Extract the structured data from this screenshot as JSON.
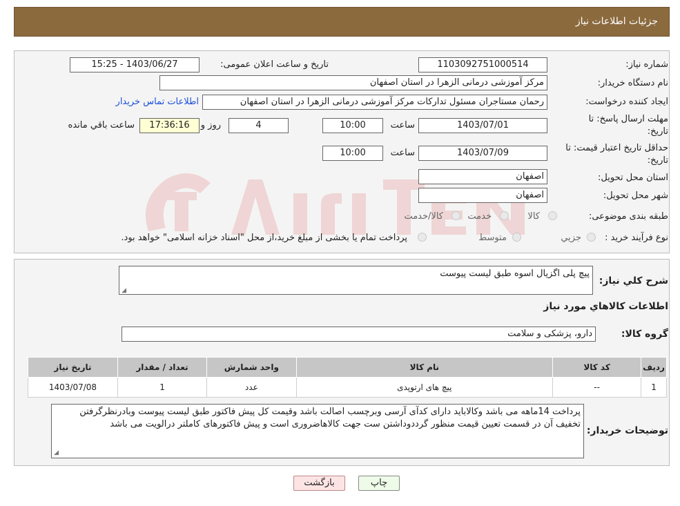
{
  "header": {
    "title": "جزئیات اطلاعات نیاز"
  },
  "form": {
    "need_number_label": "شماره نیاز:",
    "need_number": "1103092751000514",
    "announce_label": "تاریخ و ساعت اعلان عمومی:",
    "announce_value": "1403/06/27 - 15:25",
    "buyer_label": "نام دستگاه خریدار:",
    "buyer_value": "مرکز آموزشی درمانی الزهرا در استان اصفهان",
    "creator_label": "ایجاد کننده درخواست:",
    "creator_value": "رحمان مستاجران مسئول تدارکات مرکز آموزشی درمانی الزهرا در استان اصفهان",
    "contact_link": "اطلاعات تماس خریدار",
    "deadline_label_1": "مهلت ارسال پاسخ: تا",
    "deadline_label_2": "تاریخ:",
    "deadline_date": "1403/07/01",
    "time_label": "ساعت",
    "deadline_time": "10:00",
    "days_value": "4",
    "days_label": "روز و",
    "remaining_time": "17:36:16",
    "remaining_label": "ساعت باقي مانده",
    "validity_label_1": "حداقل تاریخ اعتبار قیمت: تا",
    "validity_label_2": "تاریخ:",
    "validity_date": "1403/07/09",
    "validity_time": "10:00",
    "province_label": "استان محل تحویل:",
    "province_value": "اصفهان",
    "city_label": "شهر محل تحویل:",
    "city_value": "اصفهان",
    "category_label": "طبقه بندی موضوعی:",
    "category_options": [
      "کالا",
      "خدمت",
      "کالا/خدمت"
    ],
    "process_label": "نوع فرآیند خرید :",
    "process_options": [
      "جزیي",
      "متوسط"
    ],
    "process_note": "پرداخت تمام یا بخشی از مبلغ خرید،از محل \"اسناد خزانه اسلامی\" خواهد بود."
  },
  "details": {
    "desc_label": "شرح کلي نياز:",
    "desc_value": "پیچ پلی اگزیال اسوه طبق لیست پیوست",
    "goods_info_title": "اطلاعات کالاهاي مورد نياز",
    "group_label": "گروه کالا:",
    "group_value": "دارو، پزشکی و سلامت",
    "table": {
      "headers": [
        "رديف",
        "کد کالا",
        "نام کالا",
        "واحد شمارش",
        "تعداد / مقدار",
        "تاریخ نیاز"
      ],
      "rows": [
        [
          "1",
          "--",
          "پیچ های ارتوپدی",
          "عدد",
          "1",
          "1403/07/08"
        ]
      ]
    },
    "buyer_notes_label": "توضیحات خریدار:",
    "buyer_notes_value": "پرداخت 14ماهه می باشد وکالاباید دارای کدآی آرسی وبرچسب اصالت باشد وقیمت کل پیش فاکتور طبق لیست پیوست وبادرنظرگرفتن تخفیف آن در قسمت تعیین قیمت منظور گرددوداشتن ست جهت کالاهاضروری است و پیش فاکتورهای کاملتر درالویت می باشد"
  },
  "buttons": {
    "print": "چاپ",
    "back": "بازگشت"
  }
}
